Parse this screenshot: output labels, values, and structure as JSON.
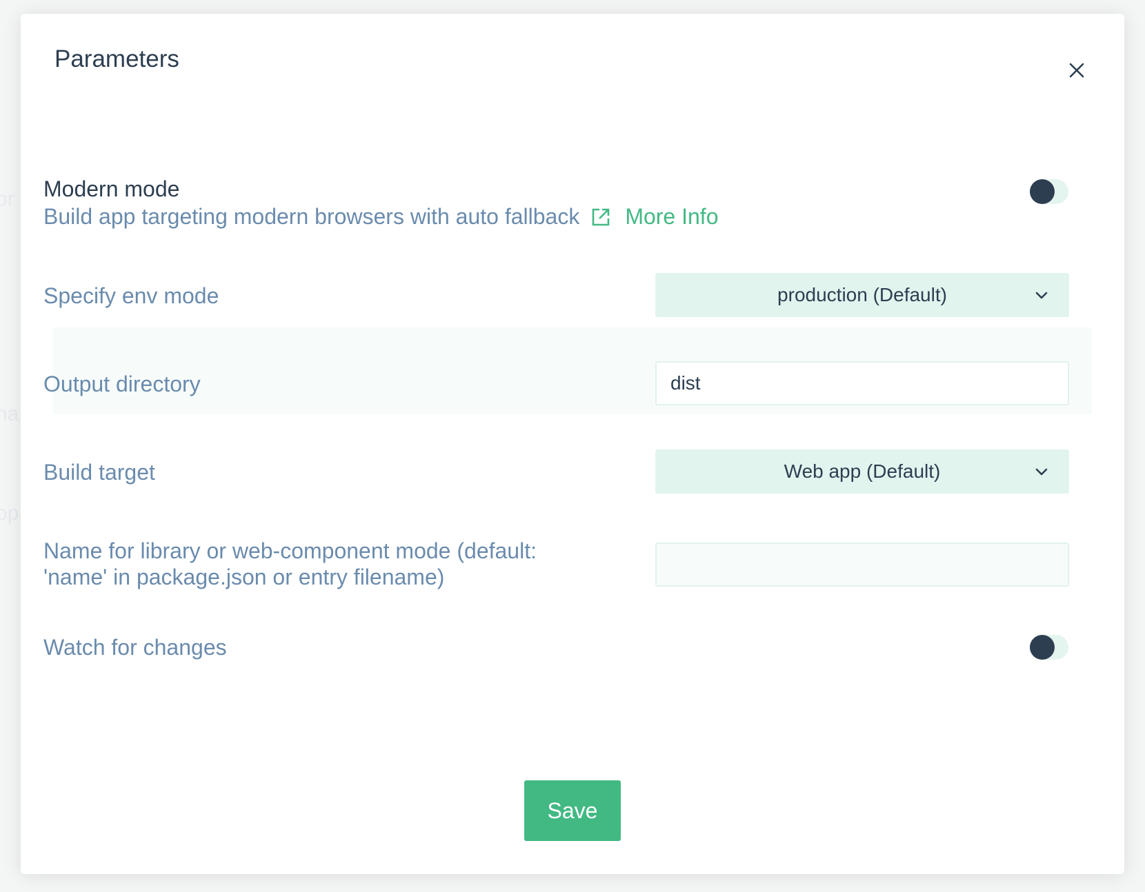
{
  "dialog": {
    "title": "Parameters",
    "close_icon": "close-icon"
  },
  "background_text": [
    "or",
    "na",
    "op"
  ],
  "modern_mode": {
    "label": "Modern mode",
    "description": "Build app targeting modern browsers with auto fallback",
    "link_icon": "external-link-icon",
    "link_label": "More Info",
    "enabled": false
  },
  "env_mode": {
    "label": "Specify env mode",
    "selected": "production (Default)"
  },
  "output_directory": {
    "label": "Output directory",
    "value": "dist"
  },
  "build_target": {
    "label": "Build target",
    "selected": "Web app (Default)"
  },
  "library_name": {
    "label_line1": "Name for library or web-component mode (default:",
    "label_line2": "'name' in package.json or entry filename)",
    "value": ""
  },
  "watch": {
    "label": "Watch for changes",
    "enabled": false
  },
  "actions": {
    "save_label": "Save"
  },
  "colors": {
    "accent": "#42b983",
    "text_dark": "#2c3e50",
    "text_muted": "#6a8bad",
    "select_bg": "#e2f4ee"
  }
}
